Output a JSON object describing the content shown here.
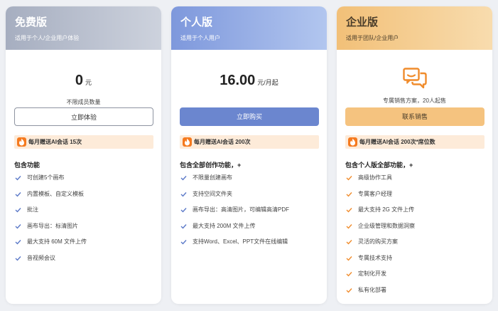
{
  "colors": {
    "free_accent": "#a6aec0",
    "personal_accent": "#6b86cf",
    "enterprise_accent": "#f5c37f",
    "check_blue": "#5b79c8",
    "check_orange": "#f08c2c",
    "fire": "#f57a1f"
  },
  "plans": {
    "free": {
      "title": "免费版",
      "subtitle": "适用于个人/企业用户体验",
      "price": "0",
      "price_unit": "元",
      "note": "不限成员数量",
      "button": "立即体验",
      "bonus": "每月赠送AI会话 15次",
      "features_title": "包含功能",
      "features": [
        "可创建5个画布",
        "内置模板、自定义模板",
        "批注",
        "画布导出：标清图片",
        "最大支持 60M 文件上传",
        "音视频会议"
      ]
    },
    "personal": {
      "title": "个人版",
      "subtitle": "适用于个人用户",
      "price": "16.00",
      "price_unit": "元/月起",
      "button": "立即购买",
      "bonus": "每月赠送AI会话 200次",
      "features_title": "包含全部创作功能，+",
      "features": [
        "不限量创建画布",
        "支持空间文件夹",
        "画布导出：高清图片，可编辑高清PDF",
        "最大支持 200M 文件上传",
        "支持Word、Excel、PPT文件在线编辑"
      ]
    },
    "enterprise": {
      "title": "企业版",
      "subtitle": "适用于团队/企业用户",
      "icon": "chat-bubbles-icon",
      "note": "专属销售方案，20人起售",
      "button": "联系销售",
      "bonus": "每月赠送AI会话 200次*席位数",
      "features_title": "包含个人版全部功能，+",
      "features": [
        "高级协作工具",
        "专属客户经理",
        "最大支持 2G 文件上传",
        "企业级管理和数据洞察",
        "灵活的购买方案",
        "专属技术支持",
        "定制化开发",
        "私有化部署"
      ]
    }
  }
}
